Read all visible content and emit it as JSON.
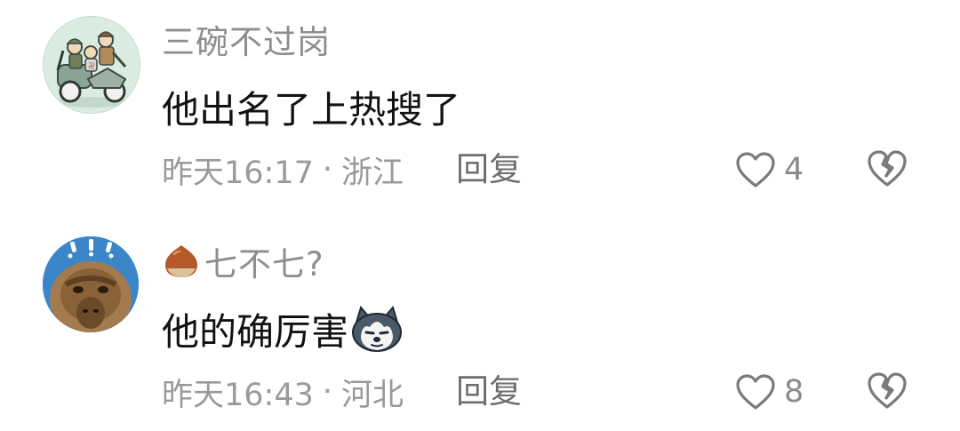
{
  "comments": [
    {
      "username": "三碗不过岗",
      "avatar_icon": "soldiers-motorcycle-cartoon-avatar",
      "content": "他出名了上热搜了",
      "time": "昨天16:17",
      "location": "浙江",
      "separator": "·",
      "reply_label": "回复",
      "likes": "4"
    },
    {
      "badge_icon": "chestnut-badge-icon",
      "username": "七不七?",
      "avatar_icon": "monkey-photo-avatar",
      "content": "他的确厉害",
      "emoji": "husky-dog-emoji",
      "time": "昨天16:43",
      "location": "河北",
      "separator": "·",
      "reply_label": "回复",
      "likes": "8"
    }
  ],
  "colors": {
    "username": "#8d8d8d",
    "content": "#121212",
    "meta": "#9a9a9a",
    "reply": "#6e6e6e",
    "icon": "#7a7a7a"
  }
}
